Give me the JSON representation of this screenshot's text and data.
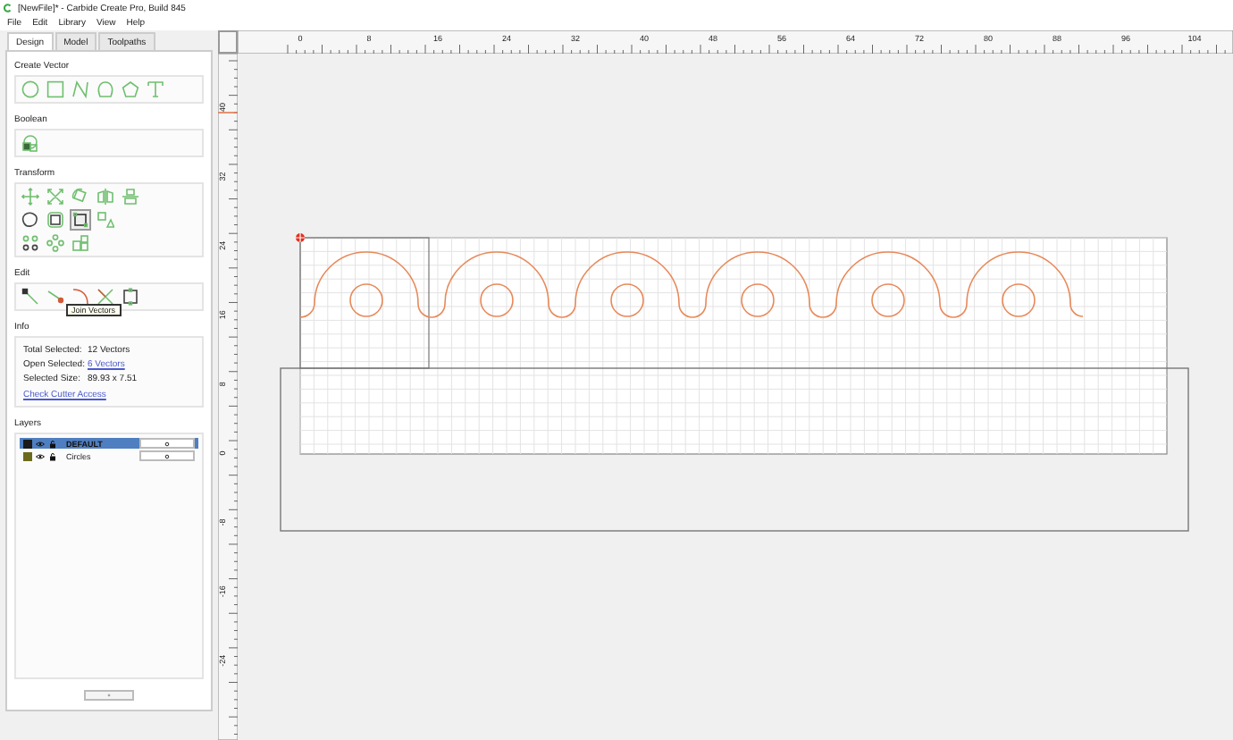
{
  "window": {
    "title": "[NewFile]* - Carbide Create Pro, Build 845"
  },
  "menu": [
    "File",
    "Edit",
    "Library",
    "View",
    "Help"
  ],
  "tabs": [
    {
      "label": "Design",
      "selected": true
    },
    {
      "label": "Model",
      "selected": false
    },
    {
      "label": "Toolpaths",
      "selected": false
    }
  ],
  "sections": {
    "create_vector": "Create Vector",
    "boolean": "Boolean",
    "transform": "Transform",
    "edit": "Edit",
    "info": "Info",
    "layers": "Layers"
  },
  "tooltip": "Join Vectors",
  "info": [
    {
      "label": "Total Selected:",
      "value": "12 Vectors",
      "kind": "text"
    },
    {
      "label": "Open Selected:",
      "value": "6 Vectors",
      "kind": "link"
    },
    {
      "label": "Selected Size:",
      "value": "89.93 x 7.51",
      "kind": "text"
    }
  ],
  "check_cutter_access": "Check Cutter Access",
  "layers": [
    {
      "name": "DEFAULT",
      "selected": true,
      "color": "#1a1a1a"
    },
    {
      "name": "Circles",
      "selected": false,
      "color": "#6b6b1e"
    }
  ],
  "ruler": {
    "x_labels": [
      "0",
      "8",
      "16",
      "24",
      "32",
      "40",
      "48",
      "56",
      "64",
      "72",
      "80",
      "88",
      "96",
      "104"
    ],
    "y_labels": [
      "40",
      "32",
      "24",
      "16",
      "8",
      "0",
      "-8",
      "-16",
      "-24"
    ]
  }
}
